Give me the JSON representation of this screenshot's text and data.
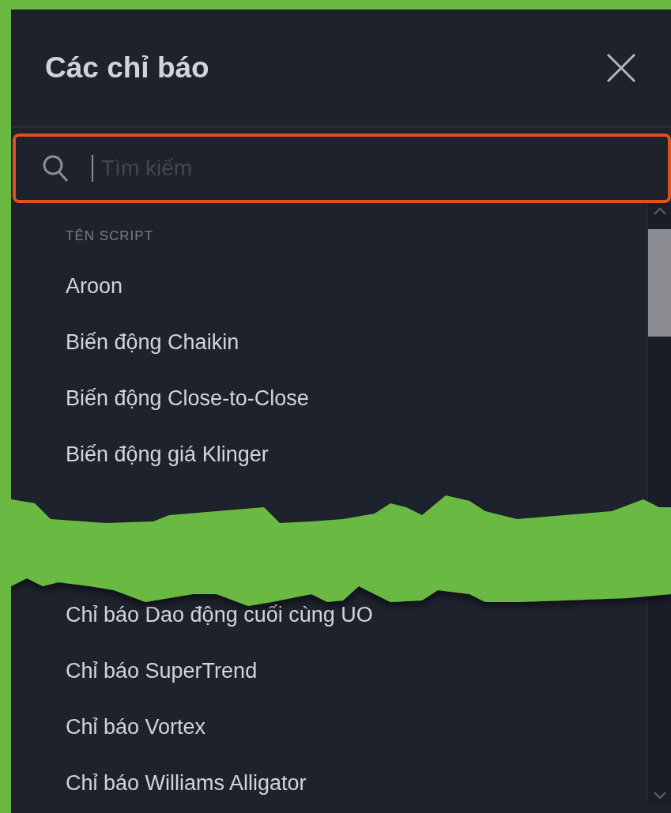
{
  "dialog": {
    "title": "Các chỉ báo"
  },
  "search": {
    "placeholder": "Tìm kiếm"
  },
  "list": {
    "heading": "TÊN SCRIPT",
    "items_before_cut": [
      "Aroon",
      "Biến động Chaikin",
      "Biến động Close-to-Close",
      "Biến động giá Klinger"
    ],
    "items_after_cut": [
      "Chỉ báo Dao động cuối cùng UO",
      "Chỉ báo SuperTrend",
      "Chỉ báo Vortex",
      "Chỉ báo Williams Alligator"
    ]
  }
}
